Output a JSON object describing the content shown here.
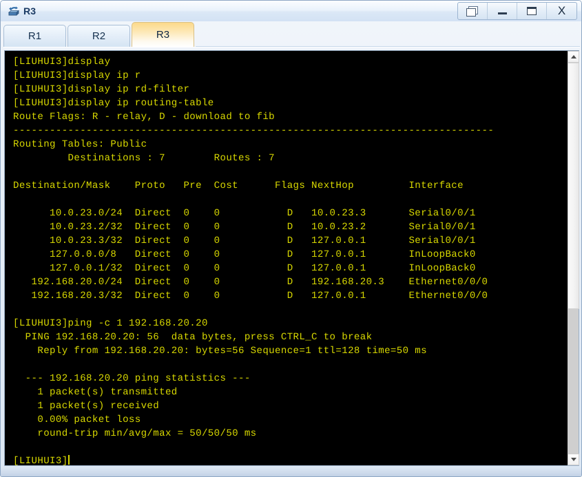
{
  "window": {
    "title": "R3",
    "icon": "router-icon",
    "buttons": [
      {
        "name": "restore-button",
        "label": "",
        "glyph": "restore-icon"
      },
      {
        "name": "minimize-button",
        "label": "",
        "glyph": "minimize-icon"
      },
      {
        "name": "maximize-button",
        "label": "",
        "glyph": "maximize-icon"
      },
      {
        "name": "close-button",
        "label": "X",
        "glyph": "close-icon"
      }
    ]
  },
  "tabs": [
    {
      "label": "R1",
      "active": false
    },
    {
      "label": "R2",
      "active": false
    },
    {
      "label": "R3",
      "active": true
    }
  ],
  "terminal": {
    "foreground": "#d8d800",
    "background": "#000000",
    "prompt": "[LIUHUI3]",
    "lines": [
      "[LIUHUI3]display",
      "[LIUHUI3]display ip r",
      "[LIUHUI3]display ip rd-filter",
      "[LIUHUI3]display ip routing-table",
      "Route Flags: R - relay, D - download to fib",
      "-------------------------------------------------------------------------------",
      "Routing Tables: Public",
      "         Destinations : 7        Routes : 7",
      "",
      "Destination/Mask    Proto   Pre  Cost      Flags NextHop         Interface",
      "",
      "      10.0.23.0/24  Direct  0    0           D   10.0.23.3       Serial0/0/1",
      "      10.0.23.2/32  Direct  0    0           D   10.0.23.2       Serial0/0/1",
      "      10.0.23.3/32  Direct  0    0           D   127.0.0.1       Serial0/0/1",
      "      127.0.0.0/8   Direct  0    0           D   127.0.0.1       InLoopBack0",
      "      127.0.0.1/32  Direct  0    0           D   127.0.0.1       InLoopBack0",
      "   192.168.20.0/24  Direct  0    0           D   192.168.20.3    Ethernet0/0/0",
      "   192.168.20.3/32  Direct  0    0           D   127.0.0.1       Ethernet0/0/0",
      "",
      "[LIUHUI3]ping -c 1 192.168.20.20",
      "  PING 192.168.20.20: 56  data bytes, press CTRL_C to break",
      "    Reply from 192.168.20.20: bytes=56 Sequence=1 ttl=128 time=50 ms",
      "",
      "  --- 192.168.20.20 ping statistics ---",
      "    1 packet(s) transmitted",
      "    1 packet(s) received",
      "    0.00% packet loss",
      "    round-trip min/avg/max = 50/50/50 ms",
      "",
      "[LIUHUI3]"
    ],
    "routing_table": {
      "flags_legend": "Route Flags: R - relay, D - download to fib",
      "table_name": "Routing Tables: Public",
      "destinations": "7",
      "routes": "7",
      "headers": [
        "Destination/Mask",
        "Proto",
        "Pre",
        "Cost",
        "Flags",
        "NextHop",
        "Interface"
      ],
      "rows": [
        [
          "10.0.23.0/24",
          "Direct",
          "0",
          "0",
          "D",
          "10.0.23.3",
          "Serial0/0/1"
        ],
        [
          "10.0.23.2/32",
          "Direct",
          "0",
          "0",
          "D",
          "10.0.23.2",
          "Serial0/0/1"
        ],
        [
          "10.0.23.3/32",
          "Direct",
          "0",
          "0",
          "D",
          "127.0.0.1",
          "Serial0/0/1"
        ],
        [
          "127.0.0.0/8",
          "Direct",
          "0",
          "0",
          "D",
          "127.0.0.1",
          "InLoopBack0"
        ],
        [
          "127.0.0.1/32",
          "Direct",
          "0",
          "0",
          "D",
          "127.0.0.1",
          "InLoopBack0"
        ],
        [
          "192.168.20.0/24",
          "Direct",
          "0",
          "0",
          "D",
          "192.168.20.3",
          "Ethernet0/0/0"
        ],
        [
          "192.168.20.3/32",
          "Direct",
          "0",
          "0",
          "D",
          "127.0.0.1",
          "Ethernet0/0/0"
        ]
      ]
    },
    "ping_result": {
      "command": "ping -c 1 192.168.20.20",
      "header": "PING 192.168.20.20: 56  data bytes, press CTRL_C to break",
      "reply": "Reply from 192.168.20.20: bytes=56 Sequence=1 ttl=128 time=50 ms",
      "stats_title": "--- 192.168.20.20 ping statistics ---",
      "transmitted": "1 packet(s) transmitted",
      "received": "1 packet(s) received",
      "loss": "0.00% packet loss",
      "round_trip": "round-trip min/avg/max = 50/50/50 ms"
    }
  },
  "scrollbar": {
    "up_arrow": "chevron-up-icon",
    "down_arrow": "chevron-down-icon",
    "thumb_fraction": "63%"
  }
}
